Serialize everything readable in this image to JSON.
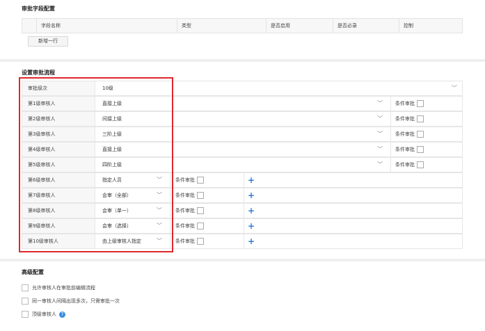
{
  "field_config": {
    "title": "审批字段配置",
    "columns": [
      "字段名称",
      "类型",
      "是否启用",
      "是否必录",
      "控制"
    ],
    "add_row_label": "新增一行"
  },
  "flow": {
    "title": "设置审批流程",
    "level_label": "审批级次",
    "level_value": "10级",
    "rows": [
      {
        "label": "第1级审核人",
        "value": "直接上级",
        "cond": "条件审批"
      },
      {
        "label": "第2级审核人",
        "value": "间接上级",
        "cond": "条件审批"
      },
      {
        "label": "第3级审核人",
        "value": "三阶上级",
        "cond": "条件审批"
      },
      {
        "label": "第4级审核人",
        "value": "直接上级",
        "cond": "条件审批"
      },
      {
        "label": "第5级审核人",
        "value": "四阶上级",
        "cond": "条件审批"
      },
      {
        "label": "第6级审核人",
        "value": "指定人员",
        "cond": "条件审批"
      },
      {
        "label": "第7级审核人",
        "value": "会审（全部）",
        "cond": "条件审批"
      },
      {
        "label": "第8级审核人",
        "value": "会审（单一）",
        "cond": "条件审批"
      },
      {
        "label": "第9级审核人",
        "value": "会审（选择）",
        "cond": "条件审批"
      },
      {
        "label": "第10级审核人",
        "value": "由上级审核人指定",
        "cond": "条件审批"
      }
    ]
  },
  "advanced": {
    "title": "高级配置",
    "options": [
      {
        "label": "允许审核人在审批前编辑流程"
      },
      {
        "label": "同一审核人间隔出现多次，只需审批一次"
      },
      {
        "label": "顶级审核人",
        "help": "?"
      }
    ]
  },
  "colors": {
    "highlight": "#e0262b",
    "accent": "#2f7bd6"
  }
}
